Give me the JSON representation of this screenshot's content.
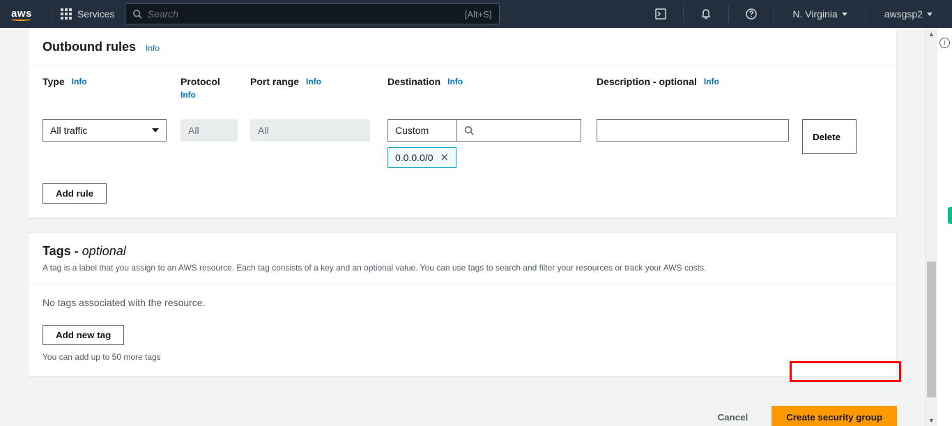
{
  "nav": {
    "logo": "aws",
    "services": "Services",
    "search_placeholder": "Search",
    "search_shortcut": "[Alt+S]",
    "region": "N. Virginia",
    "account": "awsgsp2"
  },
  "outbound": {
    "title": "Outbound rules",
    "info": "Info",
    "columns": {
      "type": "Type",
      "protocol": "Protocol",
      "port_range": "Port range",
      "destination": "Destination",
      "description": "Description - optional"
    },
    "rule": {
      "type": "All traffic",
      "protocol": "All",
      "port_range": "All",
      "dest_mode": "Custom",
      "dest_token": "0.0.0.0/0",
      "description": ""
    },
    "delete_label": "Delete",
    "add_rule_label": "Add rule"
  },
  "tags": {
    "title": "Tags - ",
    "optional": "optional",
    "description": "A tag is a label that you assign to an AWS resource. Each tag consists of a key and an optional value. You can use tags to search and filter your resources or track your AWS costs.",
    "empty": "No tags associated with the resource.",
    "add_tag_label": "Add new tag",
    "hint": "You can add up to 50 more tags"
  },
  "actions": {
    "cancel": "Cancel",
    "create": "Create security group"
  }
}
